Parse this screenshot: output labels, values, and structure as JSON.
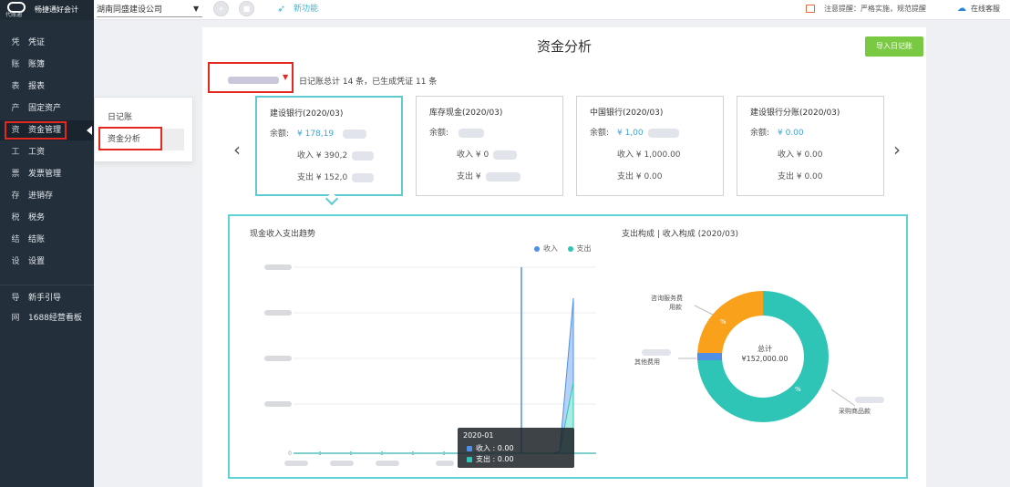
{
  "topbar": {
    "logo_mark": "代账通",
    "brand": "畅捷通好会计",
    "company": "湖南同盛建设公司",
    "tips_label": "新功能",
    "notice": "注意提醒：严格实施，规范提醒",
    "user": "在线客服"
  },
  "sidebar": {
    "items": [
      {
        "icon": "凭",
        "label": "凭证"
      },
      {
        "icon": "账",
        "label": "账簿"
      },
      {
        "icon": "表",
        "label": "报表"
      },
      {
        "icon": "产",
        "label": "固定资产"
      },
      {
        "icon": "资",
        "label": "资金管理"
      },
      {
        "icon": "工",
        "label": "工资"
      },
      {
        "icon": "票",
        "label": "发票管理"
      },
      {
        "icon": "存",
        "label": "进销存"
      },
      {
        "icon": "税",
        "label": "税务"
      },
      {
        "icon": "结",
        "label": "结账"
      },
      {
        "icon": "设",
        "label": "设置"
      },
      {
        "icon": "导",
        "label": "新手引导"
      },
      {
        "icon": "网",
        "label": "1688经营看板"
      }
    ]
  },
  "flyout": {
    "item1": "日记账",
    "item2": "资金分析"
  },
  "main": {
    "title": "资金分析",
    "green_button": "导入日记账",
    "summary": "日记账总计 14 条，已生成凭证 11 条",
    "prev": "‹",
    "next": "›"
  },
  "accounts": [
    {
      "title": "建设银行(2020/03)",
      "balance_label": "余额:",
      "balance": "¥ 178,19",
      "income": "收入 ¥ 390,2",
      "expense": "支出 ¥ 152,0"
    },
    {
      "title": "库存现金(2020/03)",
      "balance_label": "余额:",
      "balance": "",
      "income": "收入 ¥ 0",
      "expense": "支出 ¥"
    },
    {
      "title": "中国银行(2020/03)",
      "balance_label": "余额:",
      "balance": "¥ 1,00",
      "income": "收入 ¥ 1,000.00",
      "expense": "支出 ¥ 0.00"
    },
    {
      "title": "建设银行分账(2020/03)",
      "balance_label": "余额:",
      "balance": "¥ 0.00",
      "income": "收入 ¥ 0.00",
      "expense": "支出 ¥ 0.00"
    }
  ],
  "line_section": {
    "title": "现金收入支出趋势",
    "legend_income": "收入",
    "legend_expense": "支出",
    "tooltip_title": "2020-01",
    "tooltip_income": "收入 : 0.00",
    "tooltip_expense": "支出 : 0.00"
  },
  "pie_section": {
    "title": "支出构成 | 收入构成 (2020/03)",
    "center_line1": "总计",
    "center_line2": "¥152,000.00",
    "label_orange": "咨询服务费",
    "label_orange2": "用款",
    "label_mid": "其他费用",
    "label_teal": "采购商品款"
  },
  "chart_data": {
    "type": "area",
    "title": "现金收入支出趋势",
    "series": [
      {
        "name": "收入",
        "color": "#4f8fe6"
      },
      {
        "name": "支出",
        "color": "#2ec4b6"
      }
    ]
  },
  "colors": {
    "accent": "#3ab8d6",
    "green": "#7ac943",
    "highlight": "#e2281f",
    "teal": "#2ec4b6",
    "orange": "#f9a11b"
  }
}
